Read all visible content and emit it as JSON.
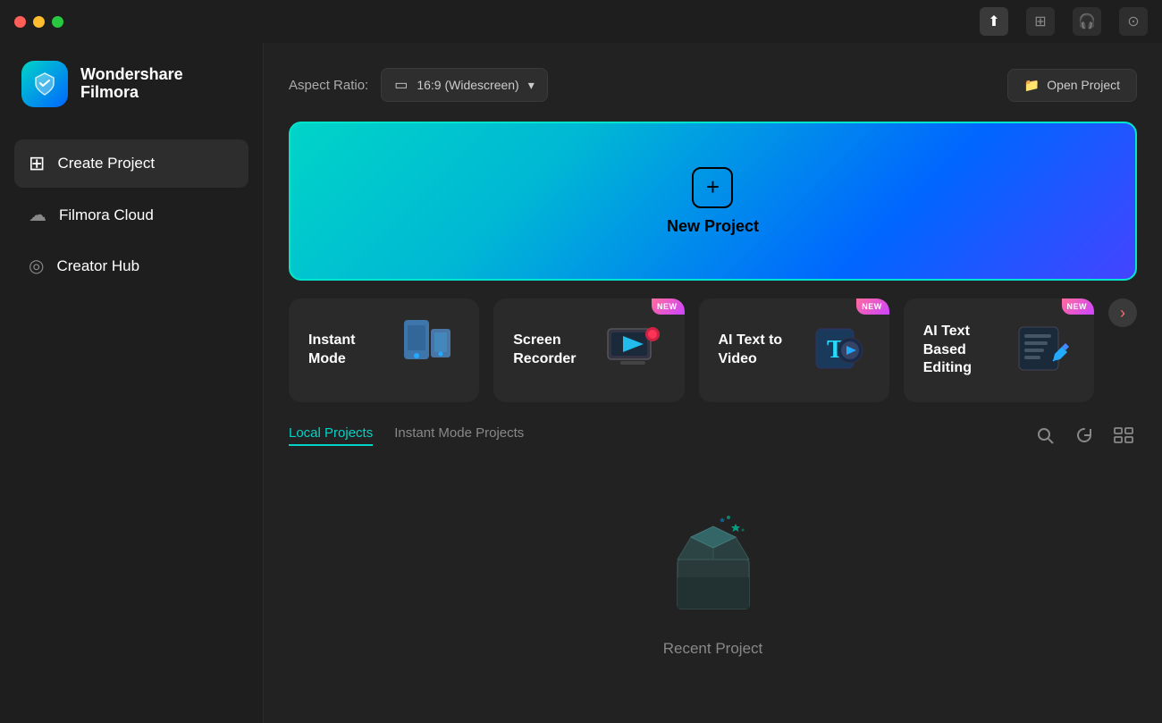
{
  "titlebar": {
    "controls": [
      "close",
      "minimize",
      "maximize"
    ],
    "icons": [
      {
        "name": "upload-icon",
        "symbol": "↑",
        "active": true
      },
      {
        "name": "grid-icon",
        "symbol": "⊞"
      },
      {
        "name": "headset-icon",
        "symbol": "🎧"
      },
      {
        "name": "settings-icon",
        "symbol": "⊙"
      }
    ]
  },
  "sidebar": {
    "brand": {
      "name_line1": "Wondershare",
      "name_line2": "Filmora"
    },
    "items": [
      {
        "id": "create-project",
        "label": "Create Project",
        "icon": "+",
        "active": true
      },
      {
        "id": "filmora-cloud",
        "label": "Filmora Cloud",
        "icon": "☁"
      },
      {
        "id": "creator-hub",
        "label": "Creator Hub",
        "icon": "◎"
      }
    ]
  },
  "content": {
    "aspect_ratio": {
      "label": "Aspect Ratio:",
      "value": "16:9 (Widescreen)"
    },
    "open_project_label": "Open Project",
    "new_project_label": "New Project",
    "quick_actions": [
      {
        "id": "instant-mode",
        "label": "Instant Mode",
        "icon": "📱",
        "badge": null
      },
      {
        "id": "screen-recorder",
        "label": "Screen Recorder",
        "icon": "🖥",
        "badge": "NEW"
      },
      {
        "id": "ai-text-to-video",
        "label": "AI Text to Video",
        "icon": "🅃",
        "badge": "NEW"
      },
      {
        "id": "ai-text-based-editing",
        "label": "AI Text Based Editing",
        "icon": "📝",
        "badge": "NEW"
      }
    ],
    "projects": {
      "tabs": [
        {
          "id": "local",
          "label": "Local Projects",
          "active": true
        },
        {
          "id": "instant",
          "label": "Instant Mode Projects",
          "active": false
        }
      ],
      "empty_state_text": "Recent Project"
    }
  }
}
